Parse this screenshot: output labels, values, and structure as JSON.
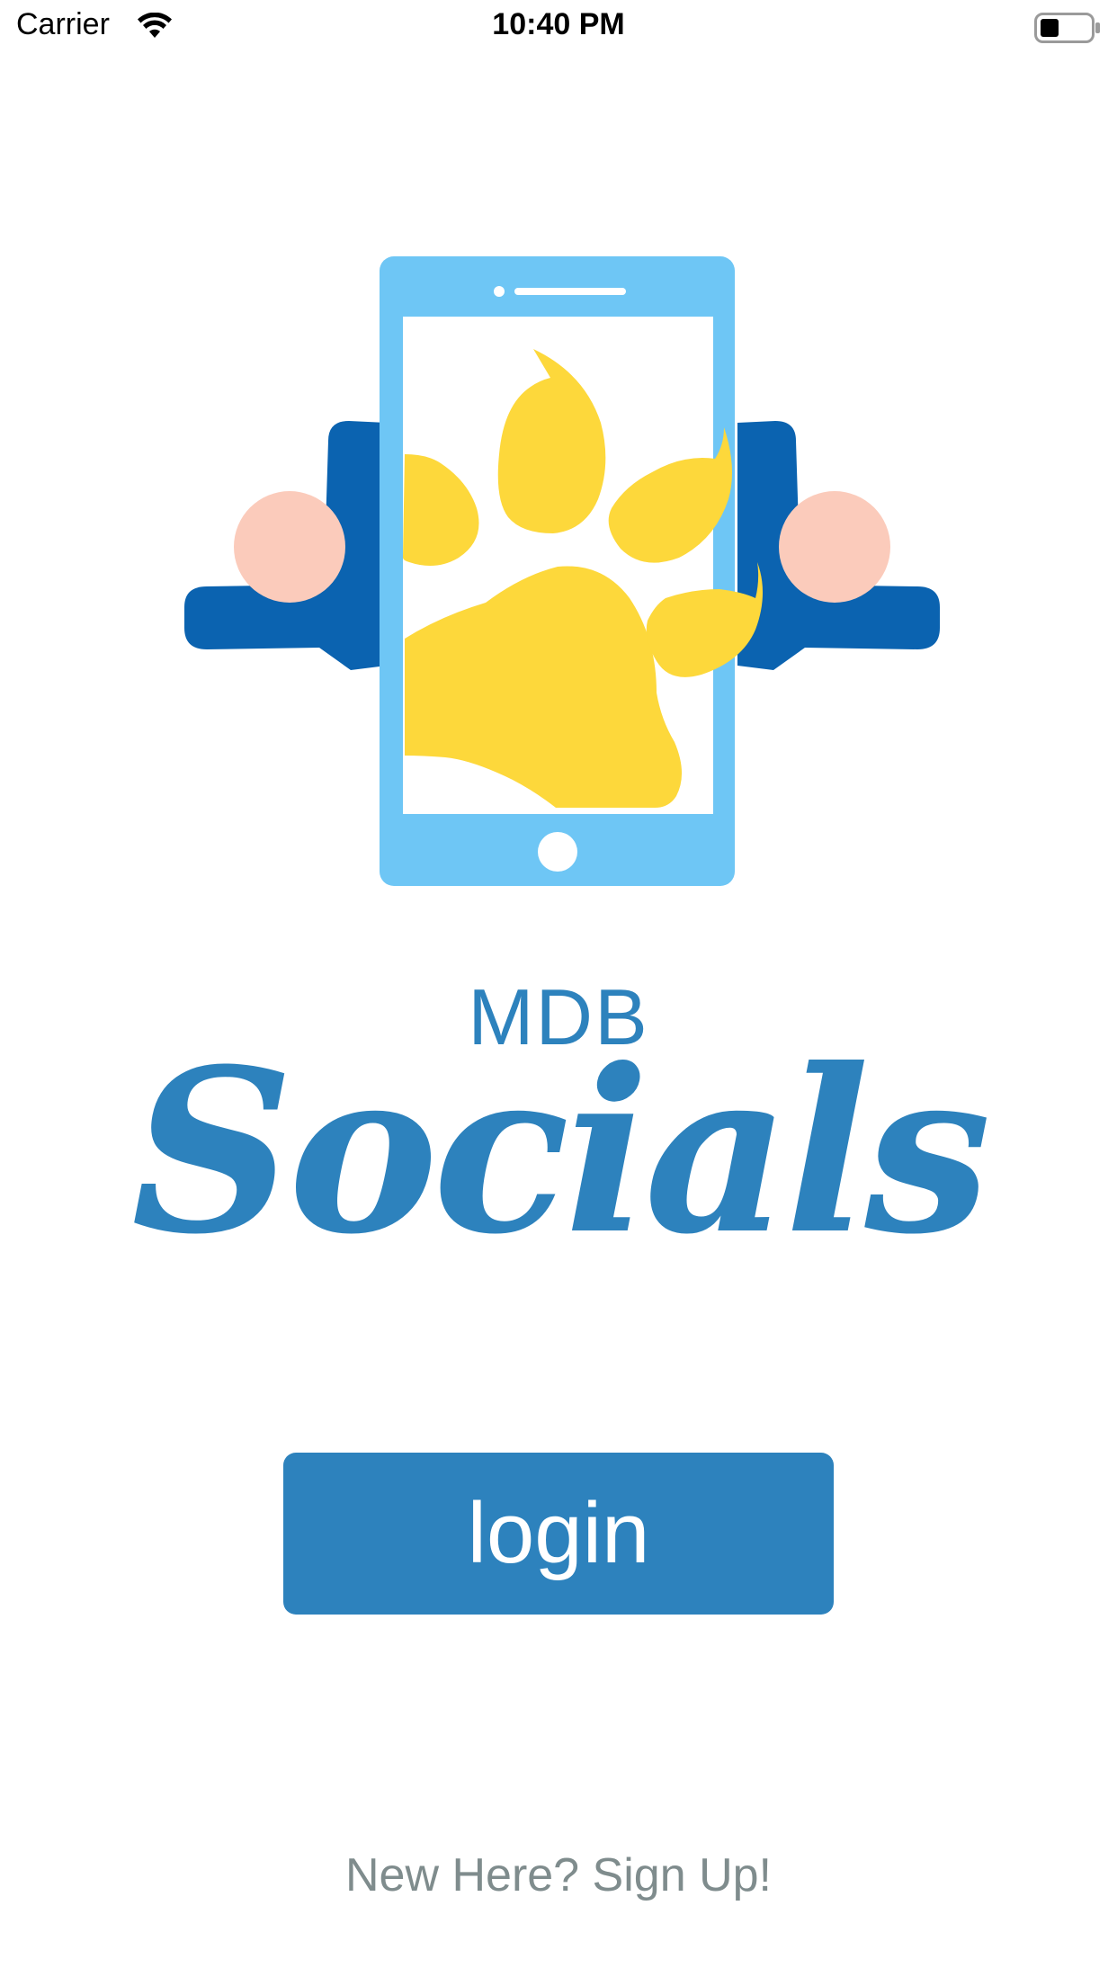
{
  "status_bar": {
    "carrier": "Carrier",
    "time": "10:40 PM",
    "wifi_icon": "wifi-icon",
    "battery_icon": "battery-icon"
  },
  "logo": {
    "icon": "phone-paw-illustration",
    "title_small": "MDB",
    "title_script": "Socials"
  },
  "actions": {
    "login_label": "login",
    "signup_label": "New Here? Sign Up!"
  },
  "colors": {
    "brand_blue": "#2d82bd",
    "phone_blue": "#6ec6f5",
    "paw_yellow": "#fdd83b",
    "person_blue": "#0b63b0",
    "skin": "#fbcbbb",
    "link_gray": "#7f8c8d"
  }
}
